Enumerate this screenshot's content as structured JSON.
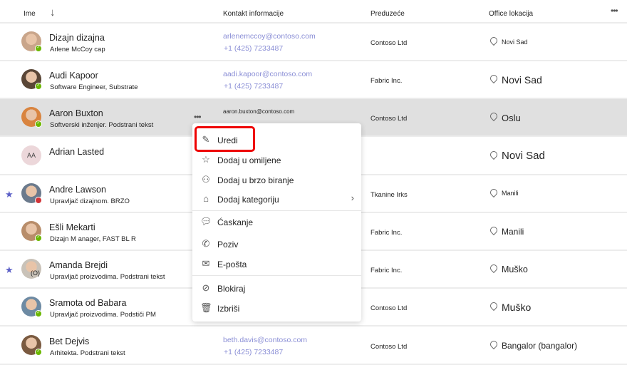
{
  "header": {
    "name": "Ime",
    "contact": "Kontakt informacije",
    "company": "Preduzeće",
    "location": "Office lokacija",
    "more": "•••"
  },
  "rows": [
    {
      "name": "Dizajn dizajna",
      "sub": "Arlene McCoy cap",
      "email": "arlenemccoy@contoso.com",
      "phone": "+1 (425) 7233487",
      "company": "Contoso Ltd",
      "location": "Novi Sad",
      "loc_size": 9,
      "status": "available",
      "avatar_color": "#c9a58a"
    },
    {
      "name": "Audi Kapoor",
      "sub": "Software Engineer, Substrate",
      "email": "aadi.kapoor@contoso.com",
      "phone": "+1 (425) 7233487",
      "company": "Fabric Inc.",
      "location": "Novi Sad",
      "loc_size": 14,
      "status": "available",
      "avatar_color": "#5a4636"
    },
    {
      "name": "Aaron Buxton",
      "sub": "Softverski inženjer. Podstrani tekst",
      "email": "aaron.buxton@contoso.com",
      "phone": "+1 (425) 7233487",
      "company": "Contoso Ltd",
      "location": "Oslu",
      "loc_size": 13,
      "status": "available",
      "avatar_color": "#d9843f",
      "selected": true,
      "more": "•••"
    },
    {
      "name": "Adrian Lasted",
      "sub": "",
      "email": "",
      "phone": "",
      "company": "",
      "location": "Novi Sad",
      "loc_size": 15,
      "status": "",
      "initials": "AA"
    },
    {
      "name": "Andre Lawson",
      "sub": "Upravljač dizajnom. BRZO",
      "email": "",
      "phone": "",
      "company": "Tkanine Irks",
      "location": "Manili",
      "loc_size": 9,
      "status": "busy",
      "avatar_color": "#6b7a8c",
      "favorite": true
    },
    {
      "name": "Ešli Mekarti",
      "sub": "Dizajn M   anager, FAST BL R",
      "email": "",
      "phone": "",
      "company": "Fabric Inc.",
      "location": "Manili",
      "loc_size": 12,
      "status": "available",
      "avatar_color": "#b88d6a"
    },
    {
      "name": "Amanda Brejdi",
      "sub": "Upravljač proizvodima. Podstrani tekst",
      "email": "",
      "phone": "",
      "company": "Fabric Inc.",
      "location": "Muško",
      "loc_size": 12.5,
      "status": "ooo",
      "status_text": "(O)",
      "avatar_color": "#c9c2b8",
      "favorite": true
    },
    {
      "name": "Sramota od Babara",
      "sub": "Upravljač proizvodima. Podstiči PM",
      "email": "",
      "phone": "",
      "company": "Contoso Ltd",
      "location": "Muško",
      "loc_size": 14,
      "status": "available",
      "avatar_color": "#6d8aa3"
    },
    {
      "name": "Bet Dejvis",
      "sub": "Arhitekta. Podstrani tekst",
      "email": "beth.davis@contoso.com",
      "phone": "+1 (425) 7233487",
      "company": "Contoso Ltd",
      "location": "Bangalor (bangalor)",
      "loc_size": 12,
      "status": "available",
      "avatar_color": "#7a5a40"
    }
  ],
  "menu": {
    "items": [
      {
        "label": "Uredi",
        "icon": "pencil-icon",
        "glyph": "✎"
      },
      {
        "label": "Dodaj u omiljene",
        "icon": "star-add-icon",
        "glyph": "☆"
      },
      {
        "label": "Dodaj u brzo biranje",
        "icon": "person-add-icon",
        "glyph": "⚇"
      },
      {
        "label": "Dodaj kategoriju",
        "icon": "tag-icon",
        "glyph": "⌂",
        "submenu": true
      },
      {
        "label": "Ćaskanje",
        "icon": "chat-icon",
        "glyph": "💬︎"
      },
      {
        "label": "Poziv",
        "icon": "phone-icon",
        "glyph": "✆"
      },
      {
        "label": "E-pošta",
        "icon": "mail-icon",
        "glyph": "✉"
      },
      {
        "label": "Blokiraj",
        "icon": "block-icon",
        "glyph": "⊘"
      },
      {
        "label": "Izbriši",
        "icon": "trash-icon",
        "glyph": "🗑︎"
      }
    ]
  },
  "colors": {
    "accent": "#5b5fc7",
    "link": "#8b8fd6",
    "highlight": "#e00000",
    "available": "#6bb700",
    "busy": "#d13438"
  }
}
